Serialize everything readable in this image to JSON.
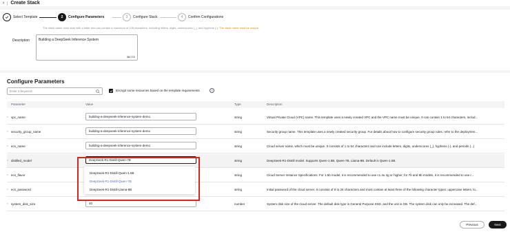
{
  "header": {
    "back_icon": "chevron-left-icon",
    "title": "Create Stack"
  },
  "steps": [
    {
      "num": "",
      "label": "Select Template",
      "state": "done"
    },
    {
      "num": "2",
      "label": "Configure Parameters",
      "state": "current"
    },
    {
      "num": "3",
      "label": "Configure Stack",
      "state": "todo"
    },
    {
      "num": "4",
      "label": "Confirm Configurations",
      "state": "todo"
    }
  ],
  "basic": {
    "hint": "The stack name must start with a letter and can contain a maximum of 128 characters, including letters, digits, underscores (_), and hyphens (-).",
    "hint_warn": "The stack name must be unique.",
    "description_label": "Description",
    "description_value": "Building a DeepSeek Inference System",
    "counter_current": "36",
    "counter_max": "/255"
  },
  "params": {
    "title": "Configure Parameters",
    "search_placeholder": "Enter a keyword",
    "encrypt_label": "Encrypt some resources based on the template requirements",
    "help_glyph": "?",
    "columns": [
      "Parameter",
      "Value",
      "Type",
      "Description"
    ],
    "rows": [
      {
        "name": "vpc_name",
        "value": "building-a-deepseek-inference-system-demo",
        "type": "string",
        "description": "Virtual Private Cloud (VPC) name. This template uses a newly created VPC and the VPC name must be unique. It can contain 1 to 54 characters, includ..."
      },
      {
        "name": "security_group_name",
        "value": "building-a-deepseek-inference-system-demo",
        "type": "string",
        "description": "Security group name. This template uses a newly created security group. For details about how to configure security group rules, refer to the deploymen..."
      },
      {
        "name": "ecs_name",
        "value": "building-a-deepseek-inference-system-demo",
        "type": "string",
        "description": "Cloud server name, which must be unique. It consists of 1 to 64 characters and can include letters, digits, underscores (_), hyphens (-), and periods (...)"
      },
      {
        "name": "distilled_model",
        "value": "DeepSeek-R1-Distill-Qwen-7B",
        "type": "string",
        "description": "DeepSeek-R1-Distill model. Supports Qwen-1.5B, Qwen-7B, Llama-8B. Default is Qwen-1.5B."
      },
      {
        "name": "ecs_flavor",
        "value": "",
        "type": "string",
        "description": "Cloud Server Instance Specifications: For 1.5b model, it is recommended to use c1.4u 4g or higher; for 7b and 8b models, it is recommended to use r..."
      },
      {
        "name": "ecs_password",
        "value": "",
        "type": "string",
        "description": "Initial password of the cloud server. It consists of 8 to 26 characters and must contain at least three of the following character types: uppercase letters, lo..."
      },
      {
        "name": "system_disk_size",
        "value": "40",
        "type": "number",
        "description": "System disk size of the cloud server. The default disk type is General Purpose SSD, and the unit is GB. The system disk can only be increased. The def..."
      }
    ],
    "dropdown_options": [
      "DeepSeek-R1-Distill-Qwen-1.5B",
      "DeepSeek-R1-Distill-Qwen-7B",
      "DeepSeek-R1-Distill-Llama-8B"
    ],
    "dropdown_selected_index": 1
  },
  "footer": {
    "previous_label": "Previous",
    "next_label": "Next"
  },
  "colors": {
    "accent": "#191919",
    "highlight": "#e0221b",
    "selected_option": "#526ecc",
    "warn": "#e8830a"
  }
}
